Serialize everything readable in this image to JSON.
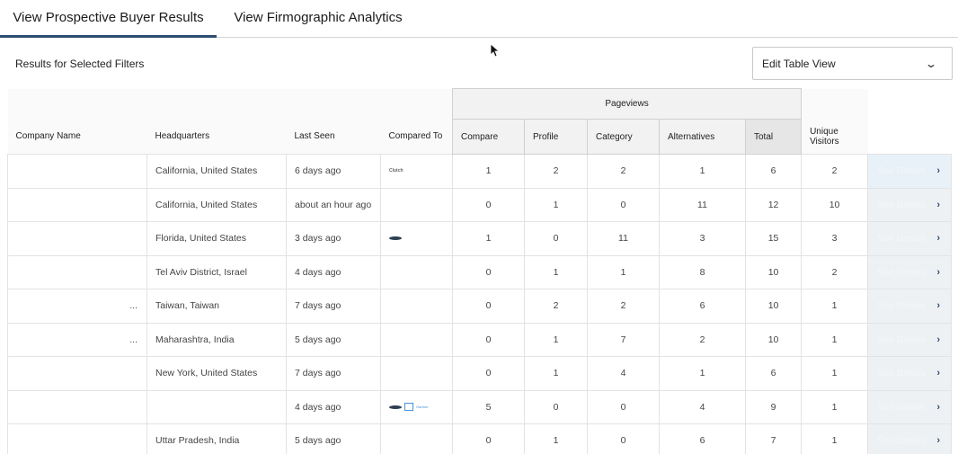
{
  "tabs": [
    {
      "label": "View Prospective Buyer Results",
      "active": true
    },
    {
      "label": "View Firmographic Analytics",
      "active": false
    }
  ],
  "results_label": "Results for Selected Filters",
  "edit_view": {
    "label": "Edit Table View",
    "chevron": "⌄"
  },
  "table": {
    "headers": {
      "company_name": "Company Name",
      "headquarters": "Headquarters",
      "last_seen": "Last Seen",
      "compared_to": "Compared To",
      "pageviews": "Pageviews",
      "compare": "Compare",
      "profile": "Profile",
      "category": "Category",
      "alternatives": "Alternatives",
      "total": "Total",
      "unique_visitors": "Unique Visitors"
    },
    "details_label": "See Details",
    "rows": [
      {
        "company": "",
        "hq": "California, United States",
        "last_seen": "6 days ago",
        "compared": [
          "clutch-logo"
        ],
        "compare": "1",
        "profile": "2",
        "category": "2",
        "alternatives": "1",
        "total": "6",
        "unique": "2"
      },
      {
        "company": "",
        "hq": "California, United States",
        "last_seen": "about an hour ago",
        "compared": [],
        "compare": "0",
        "profile": "1",
        "category": "0",
        "alternatives": "11",
        "total": "12",
        "unique": "10"
      },
      {
        "company": "",
        "hq": "Florida, United States",
        "last_seen": "3 days ago",
        "compared": [
          "oval-logo"
        ],
        "compare": "1",
        "profile": "0",
        "category": "11",
        "alternatives": "3",
        "total": "15",
        "unique": "3"
      },
      {
        "company": "",
        "hq": "Tel Aviv District, Israel",
        "last_seen": "4 days ago",
        "compared": [],
        "compare": "0",
        "profile": "1",
        "category": "1",
        "alternatives": "8",
        "total": "10",
        "unique": "2"
      },
      {
        "company": "...",
        "hq": "Taiwan, Taiwan",
        "last_seen": "7 days ago",
        "compared": [],
        "compare": "0",
        "profile": "2",
        "category": "2",
        "alternatives": "6",
        "total": "10",
        "unique": "1"
      },
      {
        "company": "...",
        "hq": "Maharashtra, India",
        "last_seen": "5 days ago",
        "compared": [],
        "compare": "0",
        "profile": "1",
        "category": "7",
        "alternatives": "2",
        "total": "10",
        "unique": "1"
      },
      {
        "company": "",
        "hq": "New York, United States",
        "last_seen": "7 days ago",
        "compared": [],
        "compare": "0",
        "profile": "1",
        "category": "4",
        "alternatives": "1",
        "total": "6",
        "unique": "1"
      },
      {
        "company": "",
        "hq": "",
        "last_seen": "4 days ago",
        "compared": [
          "oval-logo",
          "g2-logo",
          "gartner-logo"
        ],
        "compare": "5",
        "profile": "0",
        "category": "0",
        "alternatives": "4",
        "total": "9",
        "unique": "1"
      },
      {
        "company": "",
        "hq": "Uttar Pradesh, India",
        "last_seen": "5 days ago",
        "compared": [],
        "compare": "0",
        "profile": "1",
        "category": "0",
        "alternatives": "6",
        "total": "7",
        "unique": "1"
      }
    ]
  },
  "colors": {
    "accent": "#2d4d73",
    "header_bg": "#f2f2f2",
    "details_bg": "#edf1f4"
  }
}
